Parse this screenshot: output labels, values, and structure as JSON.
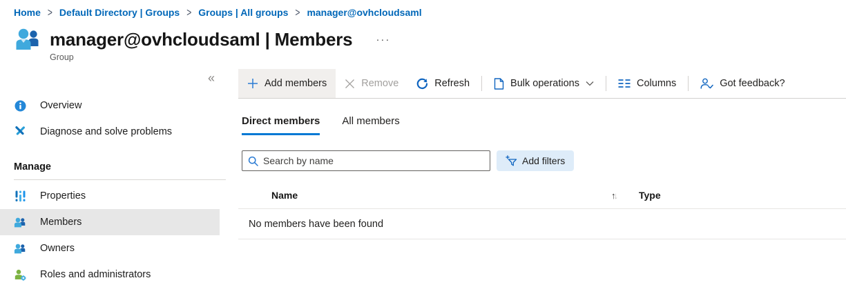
{
  "breadcrumb": {
    "items": [
      "Home",
      "Default Directory | Groups",
      "Groups | All groups",
      "manager@ovhcloudsaml"
    ],
    "separator": ">"
  },
  "header": {
    "title": "manager@ovhcloudsaml | Members",
    "subtitle": "Group",
    "more": "···"
  },
  "sidebar": {
    "collapse": "«",
    "items": [
      {
        "label": "Overview",
        "icon": "info-icon"
      },
      {
        "label": "Diagnose and solve problems",
        "icon": "diagnose-icon"
      }
    ],
    "section_title": "Manage",
    "manage_items": [
      {
        "label": "Properties",
        "icon": "properties-icon"
      },
      {
        "label": "Members",
        "icon": "members-icon",
        "selected": true
      },
      {
        "label": "Owners",
        "icon": "owners-icon"
      },
      {
        "label": "Roles and administrators",
        "icon": "roles-icon"
      }
    ]
  },
  "toolbar": {
    "add_members": "Add members",
    "remove": "Remove",
    "refresh": "Refresh",
    "bulk_operations": "Bulk operations",
    "columns": "Columns",
    "feedback": "Got feedback?"
  },
  "tabs": [
    {
      "label": "Direct members",
      "active": true
    },
    {
      "label": "All members",
      "active": false
    }
  ],
  "filter_bar": {
    "search_placeholder": "Search by name",
    "add_filters": "Add filters"
  },
  "table": {
    "columns": [
      "Name",
      "Type"
    ],
    "empty_message": "No members have been found"
  },
  "colors": {
    "accent": "#0078d4",
    "link": "#0067b8",
    "selected_bg": "#e7e7e7",
    "filter_chip_bg": "#deecf9",
    "disabled_text": "#a19f9d"
  }
}
